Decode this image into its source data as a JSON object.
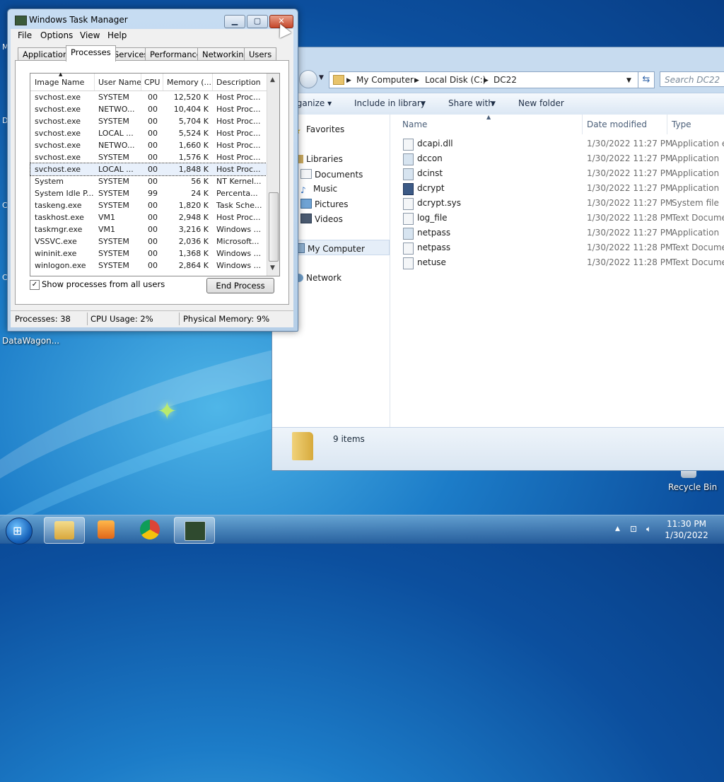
{
  "desktop": {
    "icons": [
      {
        "label": "DataWagon..."
      },
      {
        "label": "Recycle Bin"
      }
    ]
  },
  "explorer": {
    "breadcrumb": [
      "My Computer",
      "Local Disk (C:)",
      "DC22"
    ],
    "search_placeholder": "Search DC22",
    "toolbar": {
      "organize": "rganize ▾",
      "include": "Include in library",
      "share": "Share with",
      "new_folder": "New folder"
    },
    "nav": {
      "favorites": "Favorites",
      "libraries": "Libraries",
      "documents": "Documents",
      "music": "Music",
      "pictures": "Pictures",
      "videos": "Videos",
      "my_computer": "My Computer",
      "network": "Network"
    },
    "columns": {
      "name": "Name",
      "date": "Date modified",
      "type": "Type"
    },
    "files": [
      {
        "name": "dcapi.dll",
        "date": "1/30/2022 11:27 PM",
        "type": "Application ex"
      },
      {
        "name": "dccon",
        "date": "1/30/2022 11:27 PM",
        "type": "Application"
      },
      {
        "name": "dcinst",
        "date": "1/30/2022 11:27 PM",
        "type": "Application"
      },
      {
        "name": "dcrypt",
        "date": "1/30/2022 11:27 PM",
        "type": "Application"
      },
      {
        "name": "dcrypt.sys",
        "date": "1/30/2022 11:27 PM",
        "type": "System file"
      },
      {
        "name": "log_file",
        "date": "1/30/2022 11:28 PM",
        "type": "Text Documer"
      },
      {
        "name": "netpass",
        "date": "1/30/2022 11:27 PM",
        "type": "Application"
      },
      {
        "name": "netpass",
        "date": "1/30/2022 11:28 PM",
        "type": "Text Documer"
      },
      {
        "name": "netuse",
        "date": "1/30/2022 11:28 PM",
        "type": "Text Documer"
      }
    ],
    "status_count": "9 items"
  },
  "taskmgr": {
    "title": "Windows Task Manager",
    "menu": [
      "File",
      "Options",
      "View",
      "Help"
    ],
    "tabs": [
      "Applications",
      "Processes",
      "Services",
      "Performance",
      "Networking",
      "Users"
    ],
    "active_tab": "Processes",
    "columns": [
      "Image Name",
      "User Name",
      "CPU",
      "Memory (...",
      "Description"
    ],
    "rows": [
      {
        "image": "svchost.exe",
        "user": "SYSTEM",
        "cpu": "00",
        "mem": "12,520 K",
        "desc": "Host Proc..."
      },
      {
        "image": "svchost.exe",
        "user": "NETWO...",
        "cpu": "00",
        "mem": "10,404 K",
        "desc": "Host Proc..."
      },
      {
        "image": "svchost.exe",
        "user": "SYSTEM",
        "cpu": "00",
        "mem": "5,704 K",
        "desc": "Host Proc..."
      },
      {
        "image": "svchost.exe",
        "user": "LOCAL ...",
        "cpu": "00",
        "mem": "5,524 K",
        "desc": "Host Proc..."
      },
      {
        "image": "svchost.exe",
        "user": "NETWO...",
        "cpu": "00",
        "mem": "1,660 K",
        "desc": "Host Proc..."
      },
      {
        "image": "svchost.exe",
        "user": "SYSTEM",
        "cpu": "00",
        "mem": "1,576 K",
        "desc": "Host Proc..."
      },
      {
        "image": "svchost.exe",
        "user": "LOCAL ...",
        "cpu": "00",
        "mem": "1,848 K",
        "desc": "Host Proc...",
        "selected": true
      },
      {
        "image": "System",
        "user": "SYSTEM",
        "cpu": "00",
        "mem": "56 K",
        "desc": "NT Kernel..."
      },
      {
        "image": "System Idle P...",
        "user": "SYSTEM",
        "cpu": "99",
        "mem": "24 K",
        "desc": "Percenta..."
      },
      {
        "image": "taskeng.exe",
        "user": "SYSTEM",
        "cpu": "00",
        "mem": "1,820 K",
        "desc": "Task Sche..."
      },
      {
        "image": "taskhost.exe",
        "user": "VM1",
        "cpu": "00",
        "mem": "2,948 K",
        "desc": "Host Proc..."
      },
      {
        "image": "taskmgr.exe",
        "user": "VM1",
        "cpu": "00",
        "mem": "3,216 K",
        "desc": "Windows ..."
      },
      {
        "image": "VSSVC.exe",
        "user": "SYSTEM",
        "cpu": "00",
        "mem": "2,036 K",
        "desc": "Microsoft..."
      },
      {
        "image": "wininit.exe",
        "user": "SYSTEM",
        "cpu": "00",
        "mem": "1,368 K",
        "desc": "Windows ..."
      },
      {
        "image": "winlogon.exe",
        "user": "SYSTEM",
        "cpu": "00",
        "mem": "2,864 K",
        "desc": "Windows ..."
      }
    ],
    "show_all_label": "Show processes from all users",
    "show_all_checked": true,
    "end_process_label": "End Process",
    "status": {
      "processes": "Processes: 38",
      "cpu": "CPU Usage: 2%",
      "memory": "Physical Memory: 9%"
    }
  },
  "taskbar": {
    "time": "11:30 PM",
    "date": "1/30/2022"
  }
}
